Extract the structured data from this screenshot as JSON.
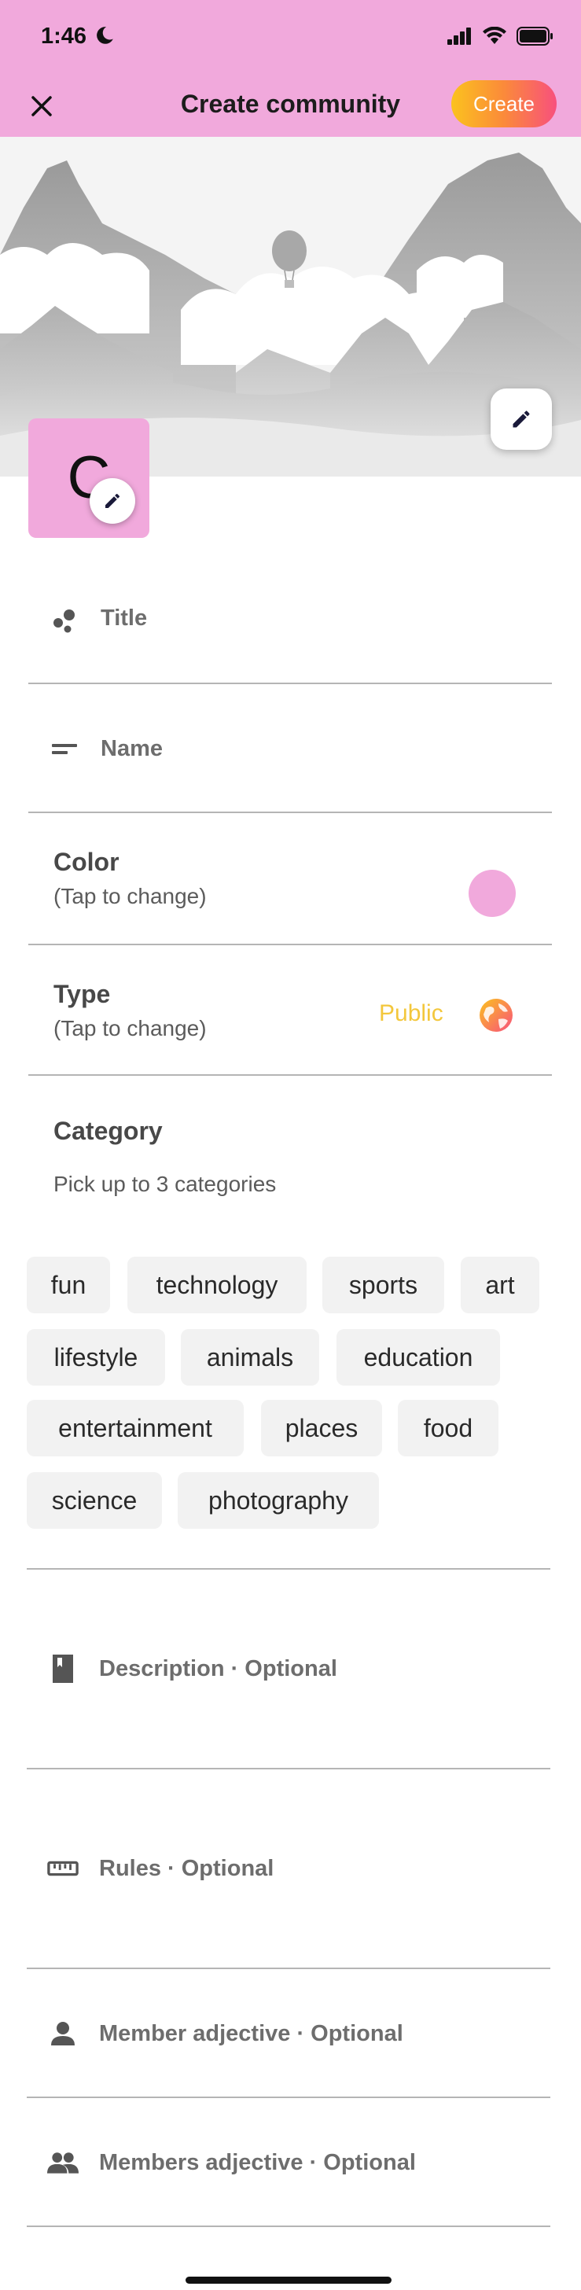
{
  "status_bar": {
    "time": "1:46"
  },
  "header": {
    "title": "Create community",
    "create_label": "Create"
  },
  "avatar": {
    "letter": "C"
  },
  "fields": {
    "title_label": "Title",
    "name_label": "Name"
  },
  "color_setting": {
    "title": "Color",
    "subtitle": "(Tap to change)",
    "value_color": "#f1a9dc"
  },
  "type_setting": {
    "title": "Type",
    "subtitle": "(Tap to change)",
    "value": "Public"
  },
  "category": {
    "title": "Category",
    "subtitle": "Pick up to 3 categories",
    "chips": [
      "fun",
      "technology",
      "sports",
      "art",
      "lifestyle",
      "animals",
      "education",
      "entertainment",
      "places",
      "food",
      "science",
      "photography"
    ]
  },
  "optional_fields": {
    "description_label": "Description · Optional",
    "rules_label": "Rules · Optional",
    "member_adjective_label": "Member adjective · Optional",
    "members_adjective_label": "Members adjective · Optional"
  },
  "colors": {
    "header_pink": "#f1a9dc",
    "create_gradient_start": "#fbc21e",
    "create_gradient_end": "#f8507d",
    "public_yellow": "#f3c73c"
  },
  "icons": {
    "close": "close-icon",
    "edit": "pencil-icon",
    "title": "bubbles-icon",
    "name": "short-text-icon",
    "type": "globe-icon",
    "description": "book-icon",
    "rules": "ruler-icon",
    "member": "person-icon",
    "members": "people-icon"
  }
}
